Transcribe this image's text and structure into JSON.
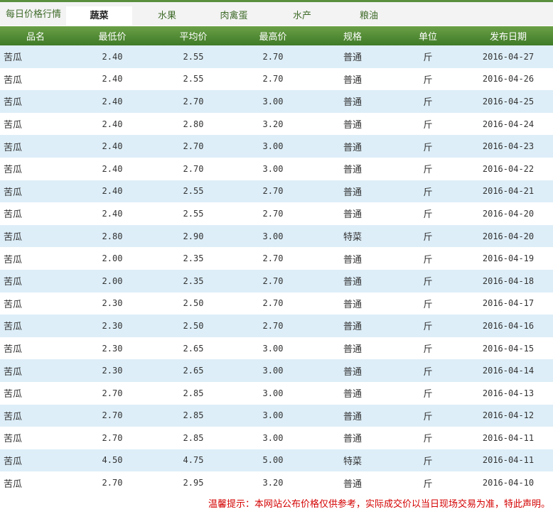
{
  "header": {
    "title": "每日价格行情",
    "tabs": [
      {
        "label": "蔬菜",
        "active": true
      },
      {
        "label": "水果",
        "active": false
      },
      {
        "label": "肉禽蛋",
        "active": false
      },
      {
        "label": "水产",
        "active": false
      },
      {
        "label": "粮油",
        "active": false
      }
    ]
  },
  "table": {
    "columns": [
      "品名",
      "最低价",
      "平均价",
      "最高价",
      "规格",
      "单位",
      "发布日期"
    ],
    "rows": [
      [
        "苦瓜",
        "2.40",
        "2.55",
        "2.70",
        "普通",
        "斤",
        "2016-04-27"
      ],
      [
        "苦瓜",
        "2.40",
        "2.55",
        "2.70",
        "普通",
        "斤",
        "2016-04-26"
      ],
      [
        "苦瓜",
        "2.40",
        "2.70",
        "3.00",
        "普通",
        "斤",
        "2016-04-25"
      ],
      [
        "苦瓜",
        "2.40",
        "2.80",
        "3.20",
        "普通",
        "斤",
        "2016-04-24"
      ],
      [
        "苦瓜",
        "2.40",
        "2.70",
        "3.00",
        "普通",
        "斤",
        "2016-04-23"
      ],
      [
        "苦瓜",
        "2.40",
        "2.70",
        "3.00",
        "普通",
        "斤",
        "2016-04-22"
      ],
      [
        "苦瓜",
        "2.40",
        "2.55",
        "2.70",
        "普通",
        "斤",
        "2016-04-21"
      ],
      [
        "苦瓜",
        "2.40",
        "2.55",
        "2.70",
        "普通",
        "斤",
        "2016-04-20"
      ],
      [
        "苦瓜",
        "2.80",
        "2.90",
        "3.00",
        "特菜",
        "斤",
        "2016-04-20"
      ],
      [
        "苦瓜",
        "2.00",
        "2.35",
        "2.70",
        "普通",
        "斤",
        "2016-04-19"
      ],
      [
        "苦瓜",
        "2.00",
        "2.35",
        "2.70",
        "普通",
        "斤",
        "2016-04-18"
      ],
      [
        "苦瓜",
        "2.30",
        "2.50",
        "2.70",
        "普通",
        "斤",
        "2016-04-17"
      ],
      [
        "苦瓜",
        "2.30",
        "2.50",
        "2.70",
        "普通",
        "斤",
        "2016-04-16"
      ],
      [
        "苦瓜",
        "2.30",
        "2.65",
        "3.00",
        "普通",
        "斤",
        "2016-04-15"
      ],
      [
        "苦瓜",
        "2.30",
        "2.65",
        "3.00",
        "普通",
        "斤",
        "2016-04-14"
      ],
      [
        "苦瓜",
        "2.70",
        "2.85",
        "3.00",
        "普通",
        "斤",
        "2016-04-13"
      ],
      [
        "苦瓜",
        "2.70",
        "2.85",
        "3.00",
        "普通",
        "斤",
        "2016-04-12"
      ],
      [
        "苦瓜",
        "2.70",
        "2.85",
        "3.00",
        "普通",
        "斤",
        "2016-04-11"
      ],
      [
        "苦瓜",
        "4.50",
        "4.75",
        "5.00",
        "特菜",
        "斤",
        "2016-04-11"
      ],
      [
        "苦瓜",
        "2.70",
        "2.95",
        "3.20",
        "普通",
        "斤",
        "2016-04-10"
      ]
    ]
  },
  "footer": {
    "notice": "温馨提示：本网站公布价格仅供参考，实际成交价以当日现场交易为准，特此声明。"
  },
  "colors": {
    "header_green": "#4f8a35",
    "row_stripe": "#ddeef8",
    "notice_red": "#d40000"
  }
}
